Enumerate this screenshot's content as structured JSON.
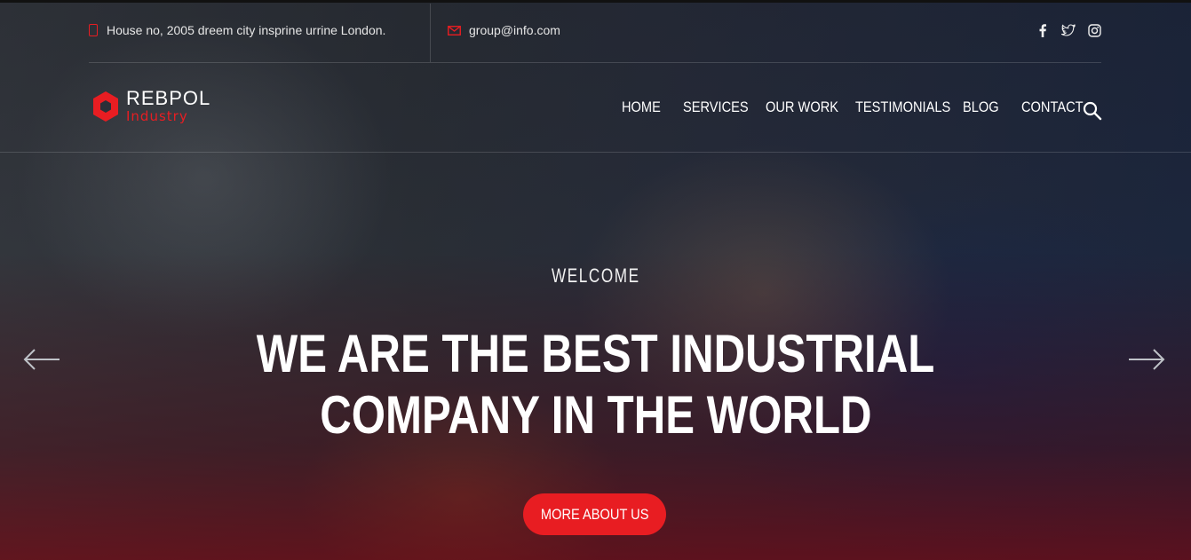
{
  "topbar": {
    "address": "House no, 2005 dreem city insprine urrine London.",
    "email": "group@info.com",
    "socials": [
      "facebook-icon",
      "twitter-icon",
      "instagram-icon"
    ]
  },
  "brand": {
    "name": "REBPOL",
    "sub": "Industry",
    "accent": "#e81d22"
  },
  "nav": {
    "items": [
      "HOME",
      "SERVICES",
      "OUR WORK",
      "TESTIMONIALS",
      "BLOG",
      "CONTACT"
    ]
  },
  "hero": {
    "kicker": "WELCOME",
    "headline_line1": "WE ARE THE BEST INDUSTRIAL",
    "headline_line2": "COMPANY IN THE WORLD",
    "cta_label": "MORE ABOUT US"
  }
}
